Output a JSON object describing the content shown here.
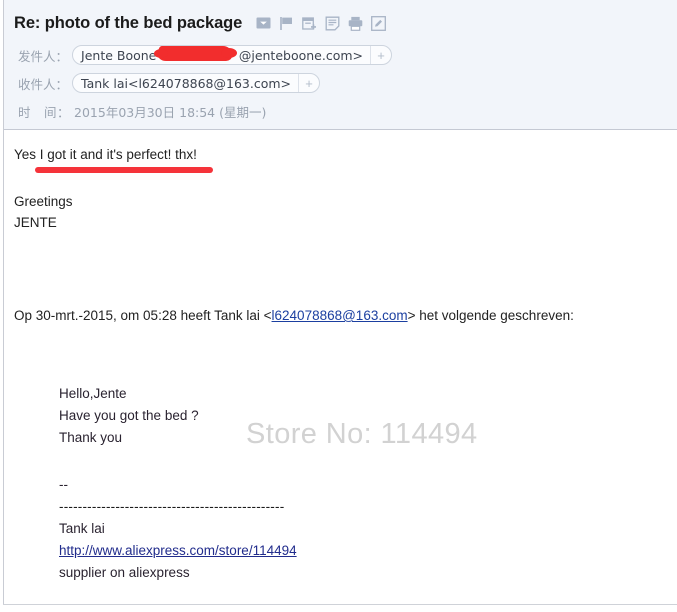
{
  "window": {
    "accent_red": "#f5333a",
    "link_blue": "#1b3fa0",
    "header_bg": "#f2f5fa"
  },
  "header": {
    "subject": "Re: photo of the bed package",
    "icons": [
      {
        "name": "envelope-dropdown-icon",
        "label": "envelope-dropdown"
      },
      {
        "name": "flag-icon",
        "label": "flag"
      },
      {
        "name": "calendar-add-icon",
        "label": "calendar-add"
      },
      {
        "name": "notes-icon",
        "label": "notes"
      },
      {
        "name": "print-icon",
        "label": "print"
      },
      {
        "name": "edit-icon",
        "label": "edit"
      }
    ],
    "sender": {
      "label": "发件人：",
      "value_prefix": "Jente Boone<",
      "value_suffix": "@jenteboone.com>",
      "add_button": "+"
    },
    "recipient": {
      "label": "收件人：",
      "value": "Tank lai<l624078868@163.com>",
      "add_button": "+"
    },
    "time": {
      "label": "时　间：",
      "value": "2015年03月30日 18:54 (星期一)"
    }
  },
  "body": {
    "reply_text": "Yes I got it and it's perfect! thx!",
    "greeting": "Greetings",
    "signature": "JENTE",
    "quote_intro_prefix": "Op 30-mrt.-2015, om 05:28 heeft Tank lai <",
    "quote_intro_link": "l624078868@163.com",
    "quote_intro_suffix": "> het volgende geschreven:",
    "watermark": "Store No: 114494",
    "quoted": {
      "line1": "Hello,Jente",
      "line2": "Have you got the bed ?",
      "line3": "Thank you",
      "dashes_short": "--",
      "dashes_long": "------------------------------------------------",
      "name": "Tank lai",
      "store_url": "http://www.aliexpress.com/store/114494",
      "tagline": "supplier on aliexpress"
    }
  }
}
